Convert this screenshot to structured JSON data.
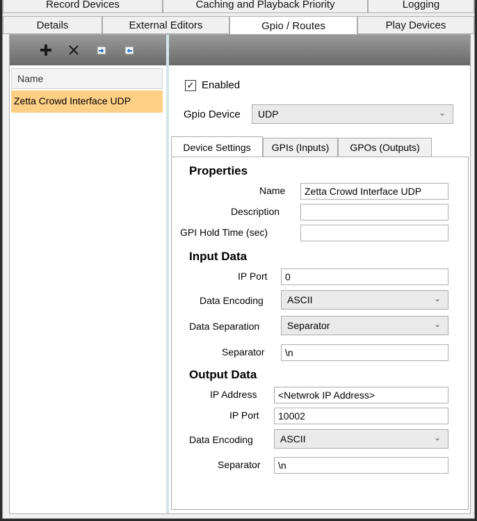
{
  "tabs_row1": [
    "Record Devices",
    "Caching and Playback Priority",
    "Logging"
  ],
  "tabs_row2": [
    "Details",
    "External Editors",
    "Gpio / Routes",
    "Play Devices"
  ],
  "toolbar": {
    "add_icon": "plus-icon",
    "delete_icon": "x-icon",
    "import_icon": "import-icon",
    "export_icon": "export-icon"
  },
  "list": {
    "header": "Name",
    "items": [
      "Zetta Crowd Interface UDP"
    ]
  },
  "enabled_label": "Enabled",
  "enabled_checked": "✓",
  "gpio_device": {
    "label": "Gpio Device",
    "value": "UDP"
  },
  "inner_tabs": [
    "Device Settings",
    "GPIs (Inputs)",
    "GPOs (Outputs)"
  ],
  "properties": {
    "heading": "Properties",
    "name_label": "Name",
    "name_value": "Zetta Crowd Interface UDP",
    "description_label": "Description",
    "description_value": "",
    "hold_label": "GPI Hold Time (sec)",
    "hold_value": ""
  },
  "input_data": {
    "heading": "Input Data",
    "ip_port_label": "IP Port",
    "ip_port_value": "0",
    "encoding_label": "Data Encoding",
    "encoding_value": "ASCII",
    "separation_label": "Data Separation",
    "separation_value": "Separator",
    "separator_label": "Separator",
    "separator_value": "\\n"
  },
  "output_data": {
    "heading": "Output Data",
    "ip_address_label": "IP Address",
    "ip_address_value": "<Netwrok IP Address>",
    "ip_port_label": "IP Port",
    "ip_port_value": "10002",
    "encoding_label": "Data Encoding",
    "encoding_value": "ASCII",
    "separator_label": "Separator",
    "separator_value": "\\n"
  }
}
